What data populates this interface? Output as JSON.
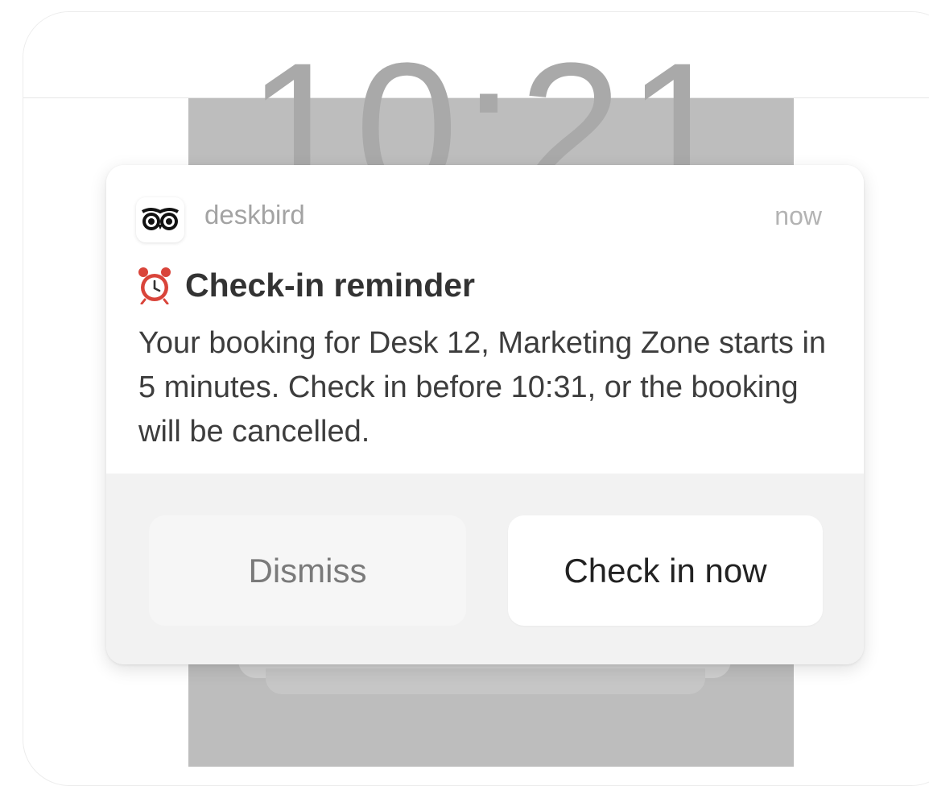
{
  "lock_screen": {
    "clock_partial": "10:21"
  },
  "notification": {
    "app_icon": "owl-eyes-icon",
    "app_name": "deskbird",
    "timestamp": "now",
    "title_icon": "alarm-clock-icon",
    "title": "Check-in reminder",
    "message": "Your booking for Desk 12, Marketing Zone starts in 5 minutes. Check in before 10:31, or the booking will be cancelled.",
    "actions": {
      "dismiss_label": "Dismiss",
      "primary_label": "Check in now"
    }
  },
  "colors": {
    "alarm_red": "#d9443a",
    "screen_gray": "#bdbdbd",
    "action_bar": "#f2f2f2"
  }
}
